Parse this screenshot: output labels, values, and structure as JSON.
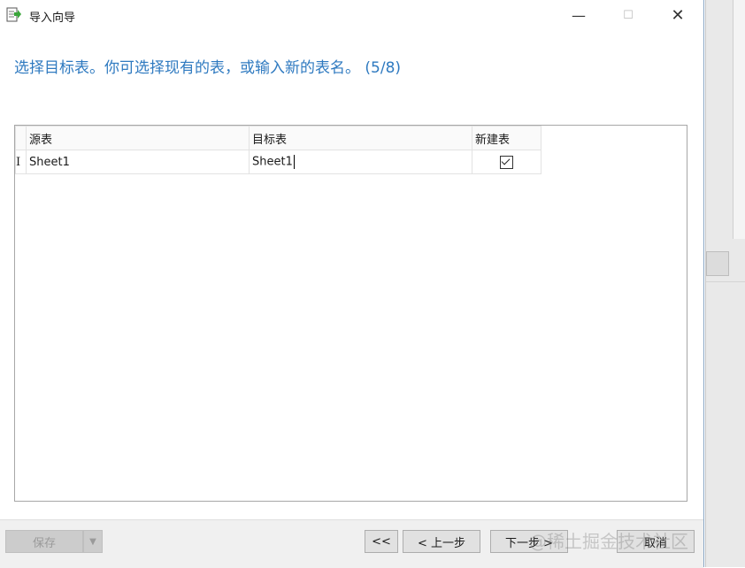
{
  "window": {
    "title": "导入向导",
    "minimize_symbol": "—",
    "maximize_symbol": "☐",
    "close_symbol": "✕"
  },
  "heading": "选择目标表。你可选择现有的表，或输入新的表名。 (5/8)",
  "table": {
    "columns": [
      "源表",
      "目标表",
      "新建表"
    ],
    "rows": [
      {
        "marker": "I",
        "source": "Sheet1",
        "target": "Sheet1",
        "new_table": true
      }
    ]
  },
  "footer": {
    "save_label": "保存",
    "dropdown_symbol": "▼",
    "first_label": "<<",
    "prev_label": "< 上一步",
    "next_label": "下一步 >",
    "cancel_label": "取消",
    "watermark": "@稀土掘金技术社区"
  },
  "colors": {
    "heading": "#2f7ac0",
    "footer_bg": "#f0f0f0"
  },
  "icons": {
    "app": "import-wizard-icon",
    "checkbox": "checkbox-checked-icon"
  }
}
